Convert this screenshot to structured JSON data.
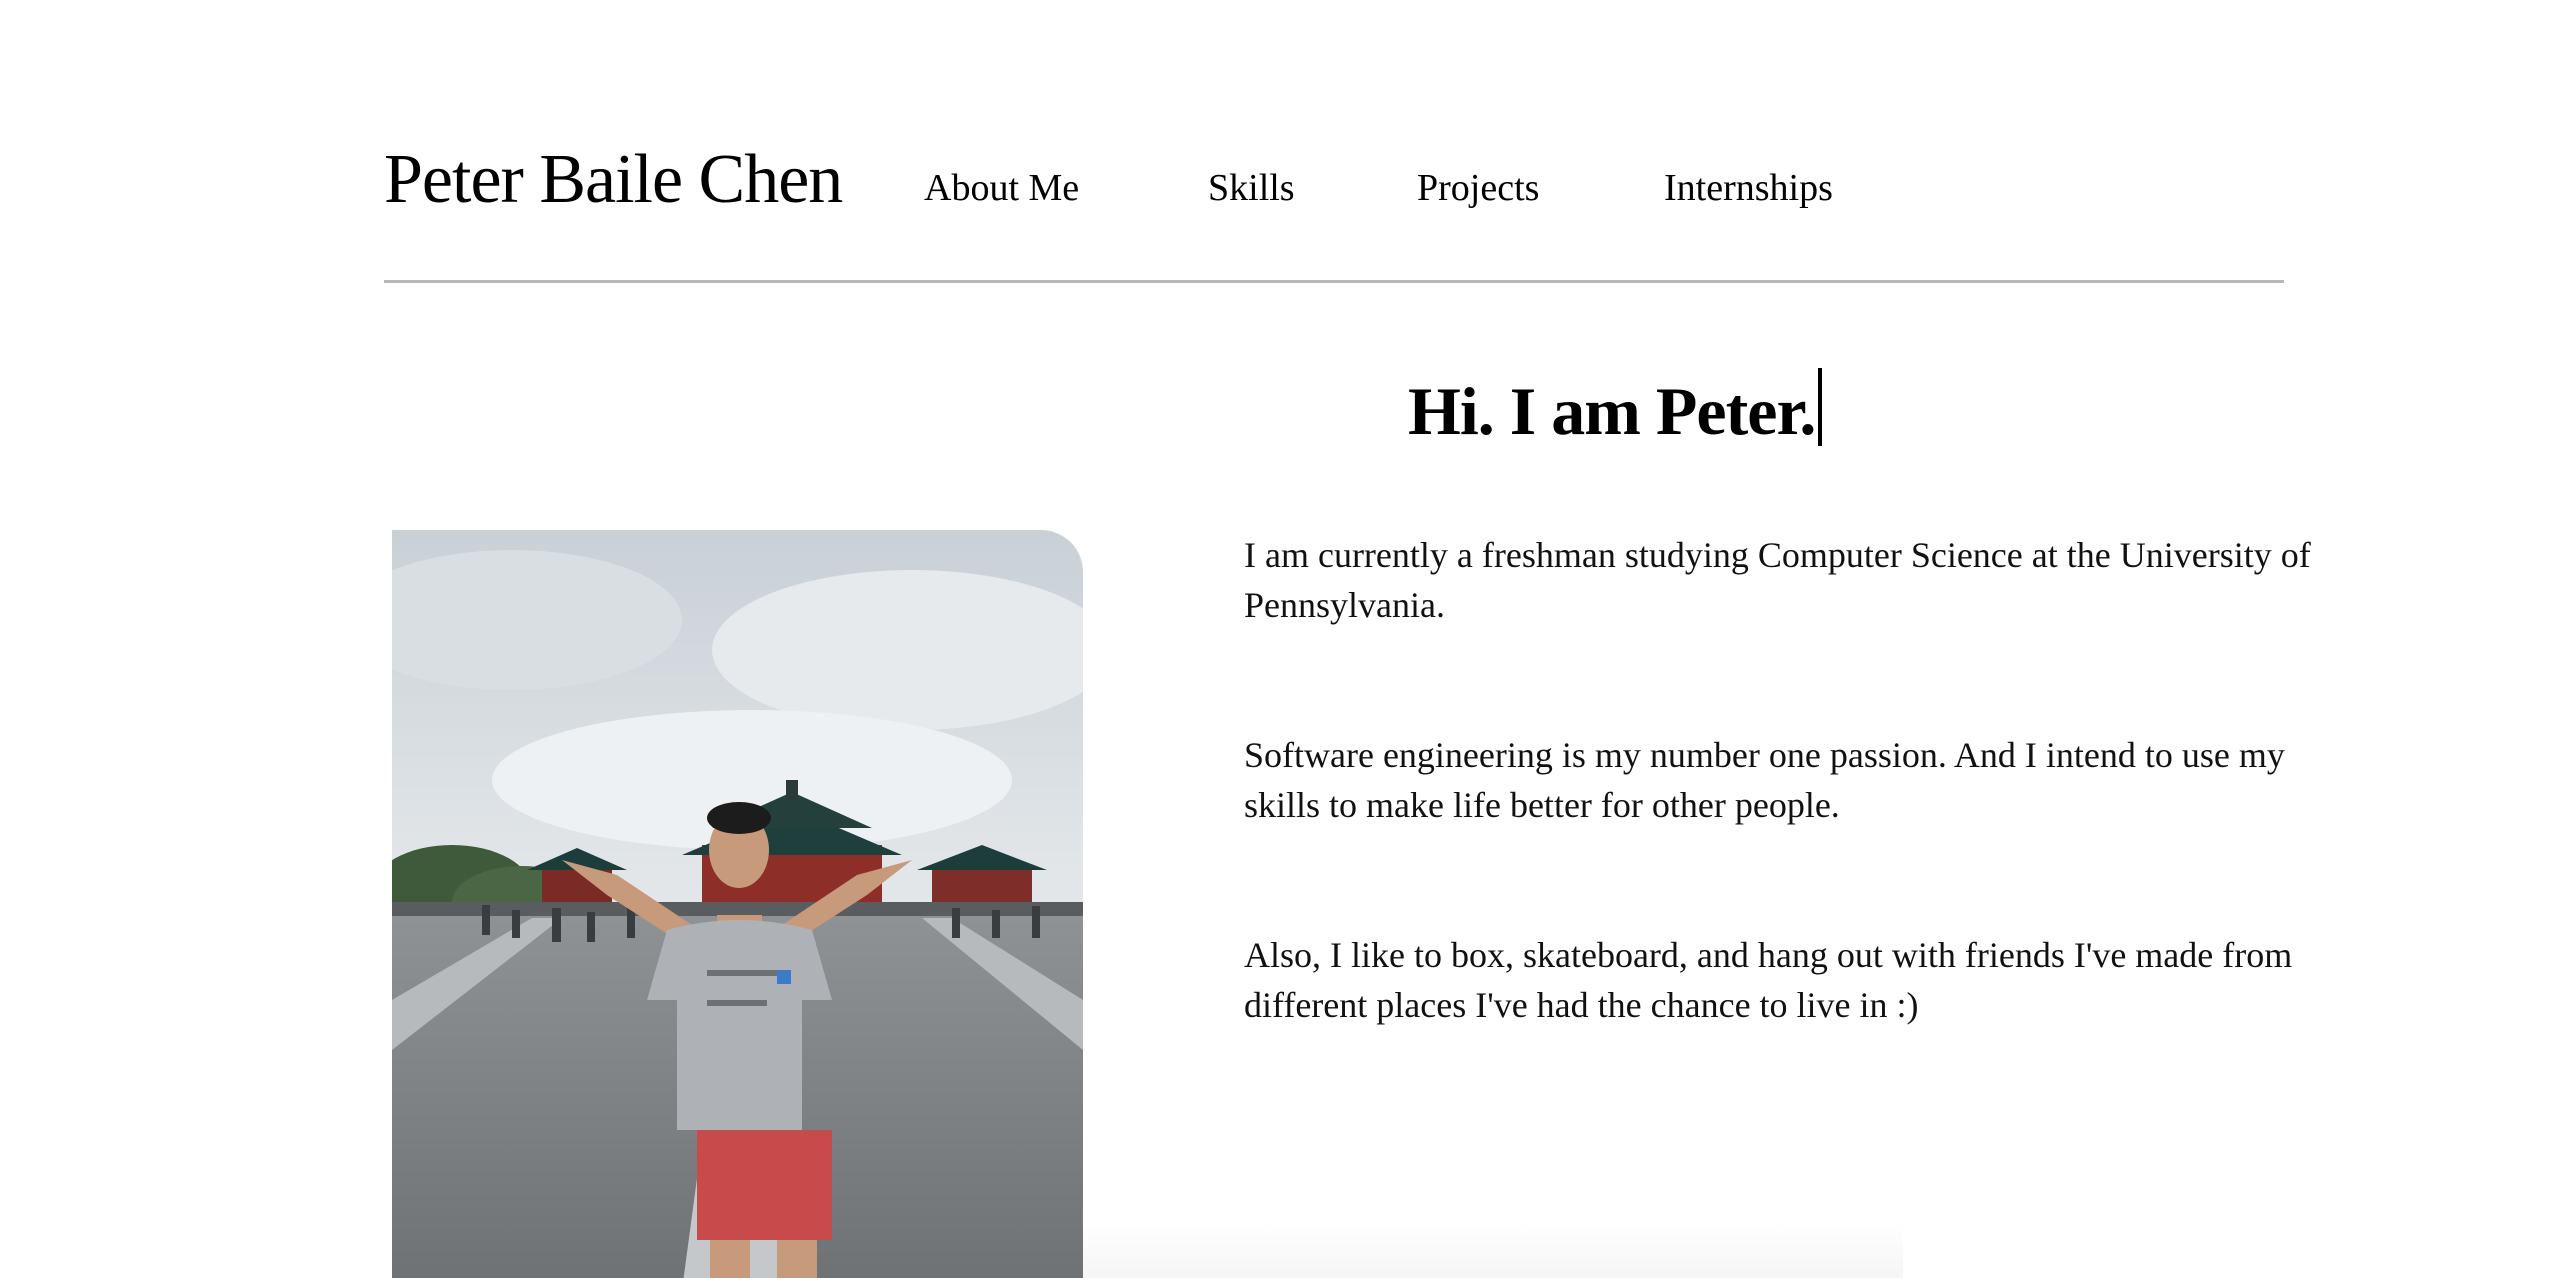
{
  "site": {
    "title": "Peter Baile Chen"
  },
  "nav": {
    "items": [
      {
        "label": "About Me"
      },
      {
        "label": "Skills"
      },
      {
        "label": "Projects"
      },
      {
        "label": "Internships"
      }
    ]
  },
  "hero": {
    "heading": "Hi. I am Peter."
  },
  "bio": {
    "paragraphs": [
      "I am currently a freshman studying Computer Science at the University of Pennsylvania.",
      "Software engineering is my number one passion. And I intend to use my skills to make life better for other people.",
      "Also, I like to box, skateboard, and hang out with friends I've made from different places I've had the chance to live in :)"
    ]
  },
  "photo": {
    "icon": "profile-photo"
  },
  "colors": {
    "text": "#000000",
    "divider": "#b8b8b8",
    "background": "#ffffff"
  }
}
